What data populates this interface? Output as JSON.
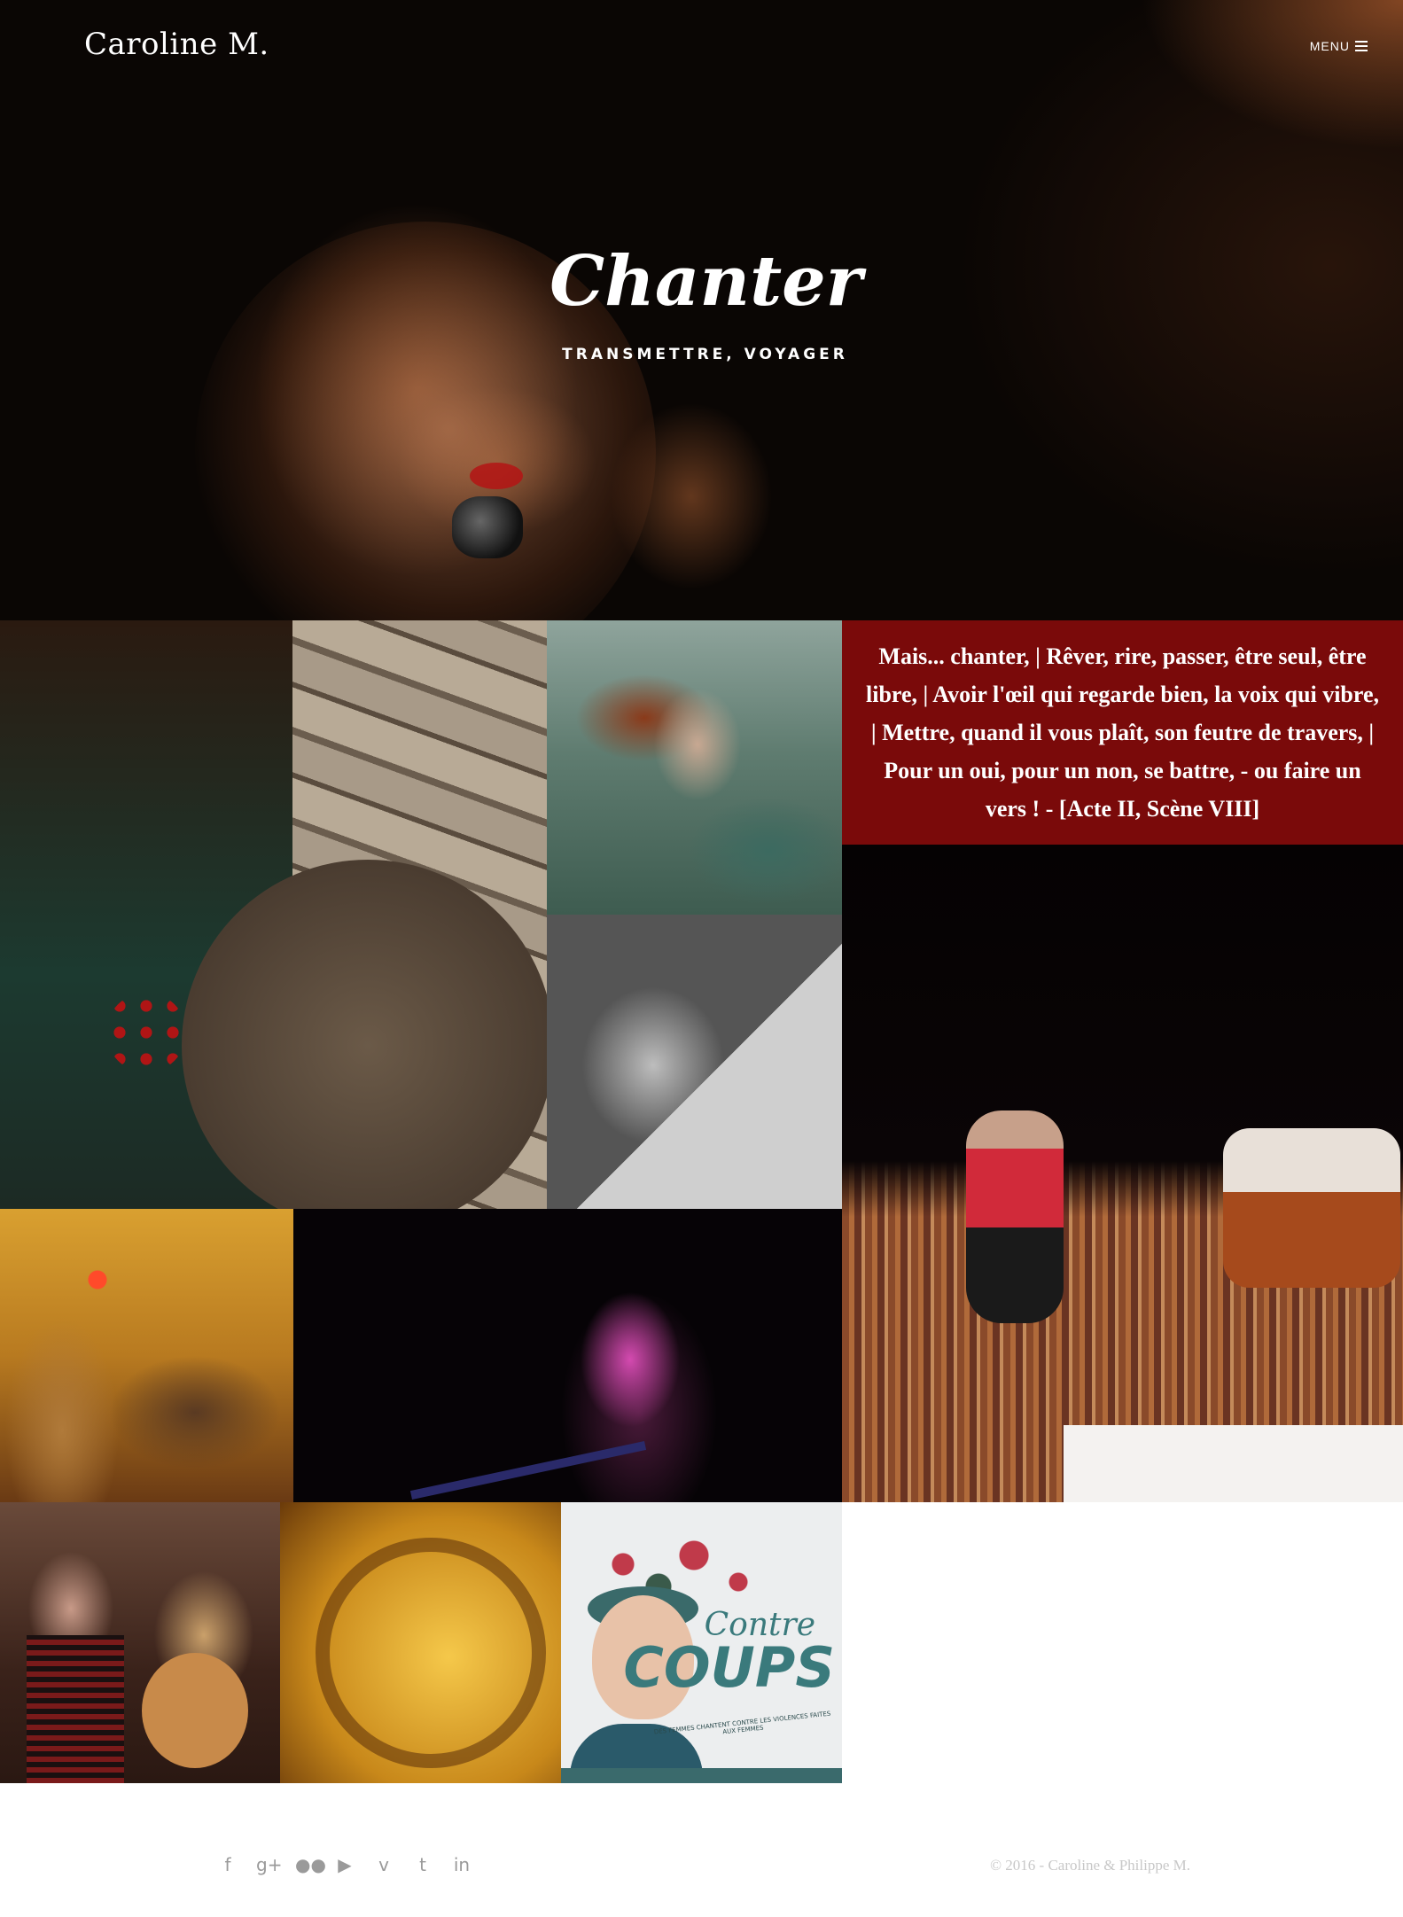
{
  "header": {
    "brand": "Caroline M.",
    "menu_label": "MENU"
  },
  "hero": {
    "title": "Chanter",
    "subtitle": "TRANSMETTRE, VOYAGER"
  },
  "quote": {
    "text": "Mais... chanter, |  Rêver, rire, passer, être seul, être libre, |  Avoir l'œil qui regarde bien, la voix qui vibre, |  Mettre, quand il vous plaît, son feutre de travers, |  Pour un oui, pour un non, se battre, - ou faire un vers ! - [Acte II, Scène VIII]"
  },
  "poster": {
    "title_line1": "Contre",
    "title_line2": "COUPS",
    "subtitle": "DES FEMMES CHANTENT CONTRE LES VIOLENCES FAITES AUX FEMMES"
  },
  "footer": {
    "social_icons": [
      "facebook-icon",
      "google-plus-icon",
      "flickr-icon",
      "youtube-icon",
      "vimeo-icon",
      "tumblr-icon",
      "linkedin-icon"
    ],
    "copyright": "© 2016 - Caroline & Philippe M."
  },
  "colors": {
    "quote_bg": "#7a0a0a",
    "hero_bg": "#0a0604",
    "footer_text": "#c8c8c8",
    "social_icon": "#9a9a9a"
  }
}
